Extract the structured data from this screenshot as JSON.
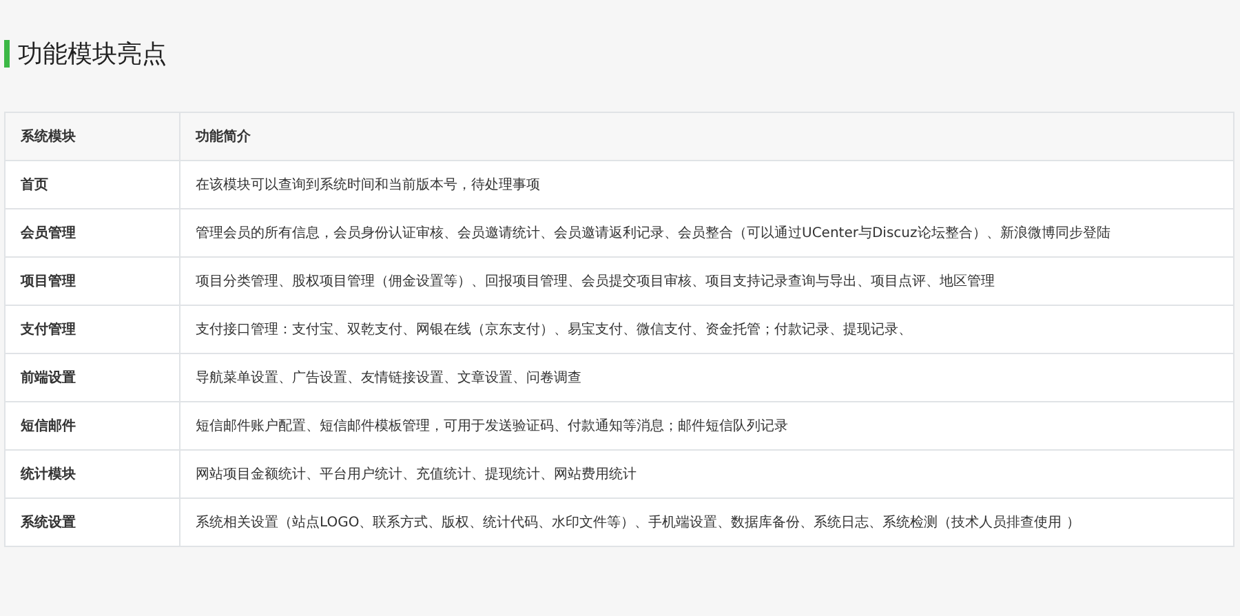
{
  "heading": "功能模块亮点",
  "table": {
    "columns": [
      "系统模块",
      "功能简介"
    ],
    "rows": [
      {
        "module": "首页",
        "description": "在该模块可以查询到系统时间和当前版本号，待处理事项"
      },
      {
        "module": "会员管理",
        "description": "管理会员的所有信息，会员身份认证审核、会员邀请统计、会员邀请返利记录、会员整合（可以通过UCenter与Discuz论坛整合）、新浪微博同步登陆"
      },
      {
        "module": "项目管理",
        "description": "项目分类管理、股权项目管理（佣金设置等）、回报项目管理、会员提交项目审核、项目支持记录查询与导出、项目点评、地区管理"
      },
      {
        "module": "支付管理",
        "description": "支付接口管理：支付宝、双乾支付、网银在线（京东支付）、易宝支付、微信支付、资金托管；付款记录、提现记录、"
      },
      {
        "module": "前端设置",
        "description": "导航菜单设置、广告设置、友情链接设置、文章设置、问卷调查"
      },
      {
        "module": "短信邮件",
        "description": "短信邮件账户配置、短信邮件模板管理，可用于发送验证码、付款通知等消息；邮件短信队列记录"
      },
      {
        "module": "统计模块",
        "description": "网站项目金额统计、平台用户统计、充值统计、提现统计、网站费用统计"
      },
      {
        "module": "系统设置",
        "description": "系统相关设置（站点LOGO、联系方式、版权、统计代码、水印文件等）、手机端设置、数据库备份、系统日志、系统检测（技术人员排查使用 ）"
      }
    ]
  }
}
